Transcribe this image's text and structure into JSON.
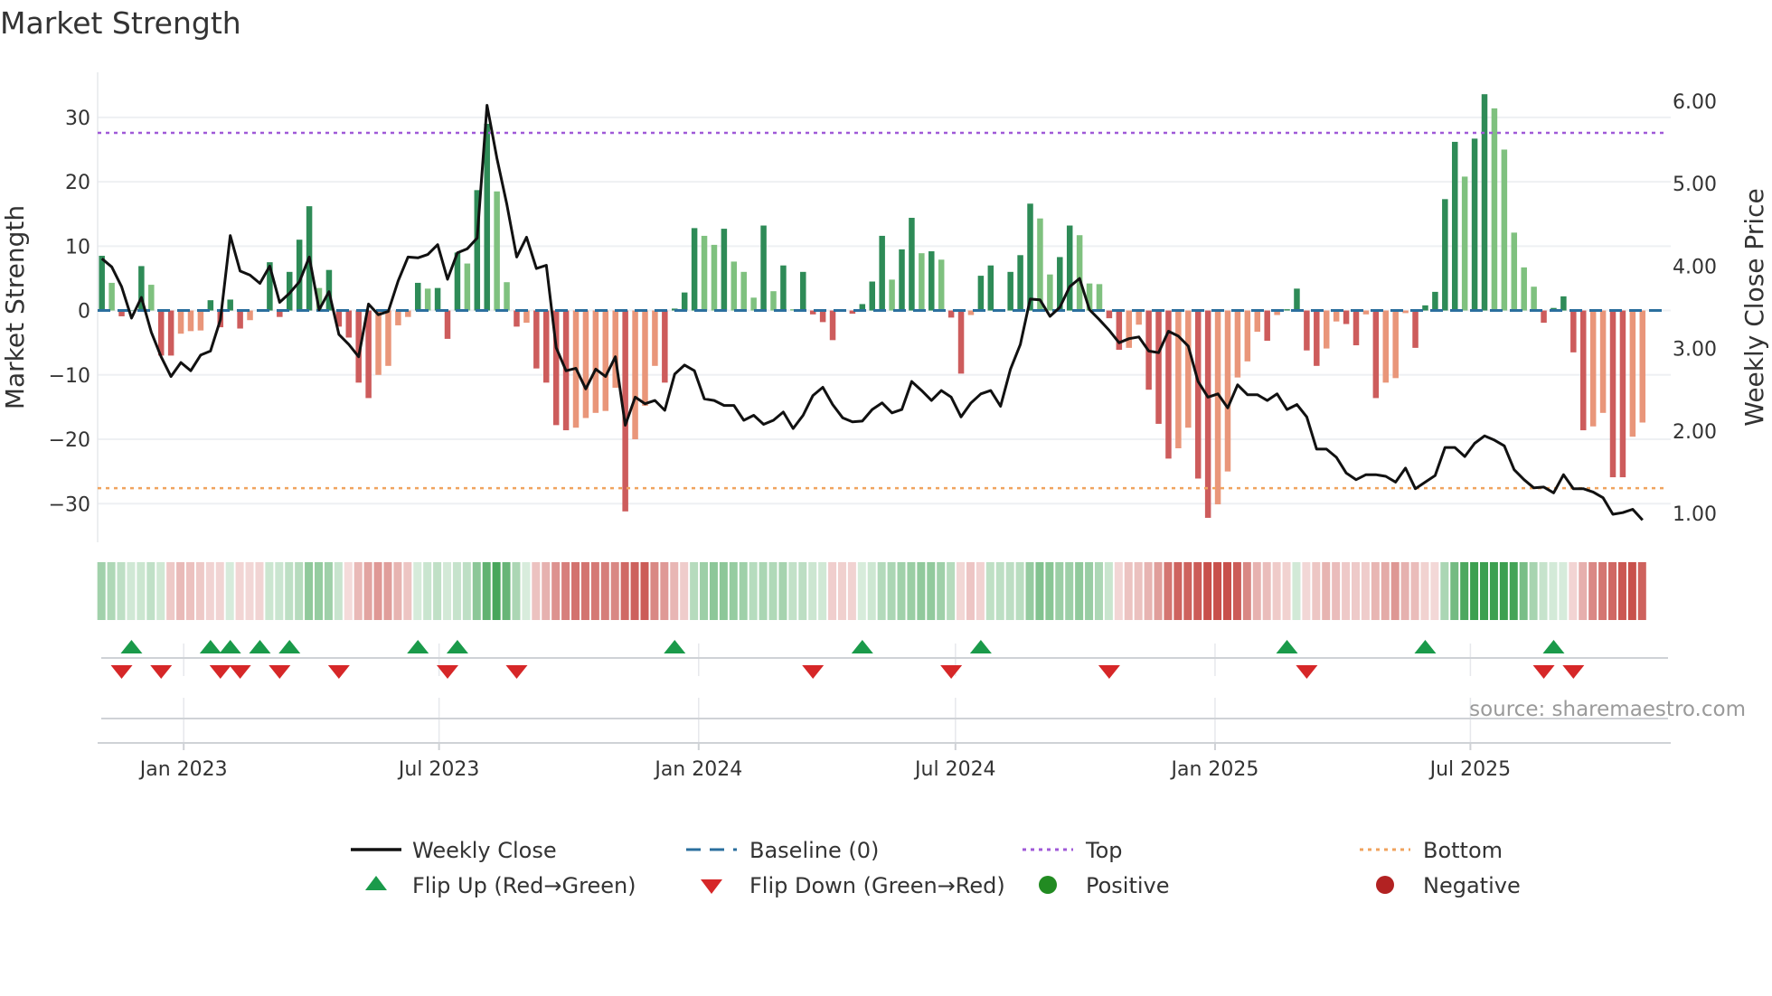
{
  "chart_data": {
    "type": "bar",
    "title": "Market Strength",
    "ylabel": "Market Strength",
    "y2label": "Weekly Close Price",
    "source": "source: sharemaestro.com",
    "x_start": "2022-11-04",
    "x_step_days": 7,
    "xlim": [
      "2022-11-01",
      "2025-11-20"
    ],
    "ylim": [
      -36,
      37
    ],
    "y2lim": [
      0.65,
      6.35
    ],
    "yticks": [
      30,
      20,
      10,
      0,
      -10,
      -20,
      -30
    ],
    "yticklabels": [
      "30",
      "20",
      "10",
      "0",
      "−10",
      "−20",
      "−30"
    ],
    "y2ticks": [
      6,
      5,
      4,
      3,
      2,
      1
    ],
    "y2ticklabels": [
      "6.00",
      "5.00",
      "4.00",
      "3.00",
      "2.00",
      "1.00"
    ],
    "xticks": [
      "2023-01-01",
      "2023-07-01",
      "2024-01-01",
      "2024-07-01",
      "2025-01-01",
      "2025-07-01"
    ],
    "xticklabels": [
      "Jan 2023",
      "Jul 2023",
      "Jan 2024",
      "Jul 2024",
      "Jan 2025",
      "Jul 2025"
    ],
    "top_level": 27.6,
    "bottom_level": -27.6,
    "strength": [
      8.5,
      4.3,
      -0.9,
      0,
      6.9,
      4.0,
      -7.0,
      -7.0,
      -3.6,
      -3.2,
      -3.1,
      1.6,
      -2.6,
      1.7,
      -2.8,
      -1.5,
      0,
      7.5,
      -1.0,
      6.0,
      11.0,
      16.2,
      3.5,
      6.3,
      -2.5,
      -4.2,
      -11.2,
      -13.6,
      -10.0,
      -8.6,
      -2.3,
      -1.0,
      4.3,
      3.4,
      3.5,
      -4.4,
      9.0,
      7.3,
      18.7,
      29.0,
      18.5,
      4.4,
      -2.5,
      -1.9,
      -9.0,
      -11.2,
      -17.8,
      -18.6,
      -18.2,
      -16.7,
      -15.9,
      -15.6,
      -12.0,
      -31.2,
      -20.0,
      -14.8,
      -8.6,
      -11.2,
      0.3,
      2.8,
      12.8,
      11.6,
      10.2,
      12.7,
      7.6,
      6.0,
      2.0,
      13.2,
      3.0,
      7.0,
      0.2,
      6.0,
      -0.6,
      -1.8,
      -4.6,
      0,
      -0.5,
      1.0,
      4.5,
      11.6,
      4.8,
      9.5,
      14.4,
      8.9,
      9.2,
      7.9,
      -1.1,
      -9.8,
      -0.7,
      5.4,
      7.0,
      0,
      6.0,
      8.6,
      16.6,
      14.3,
      5.6,
      8.3,
      13.2,
      11.7,
      4.2,
      4.1,
      -1.2,
      -6.1,
      -5.8,
      -2.2,
      -12.3,
      -17.6,
      -23.0,
      -21.4,
      -18.2,
      -26.1,
      -32.2,
      -30.1,
      -25.0,
      -10.4,
      -7.9,
      -3.3,
      -4.7,
      -0.7,
      0.2,
      3.4,
      -6.2,
      -8.6,
      -5.9,
      -1.7,
      -2.1,
      -5.4,
      -0.6,
      -13.6,
      -11.2,
      -10.5,
      -0.4,
      -5.8,
      0.8,
      2.9,
      17.3,
      26.2,
      20.8,
      26.7,
      33.6,
      31.4,
      25.0,
      12.1,
      6.7,
      3.7,
      -1.9,
      0.4,
      2.2,
      -6.5,
      -18.6,
      -18.0,
      -15.9,
      -25.9,
      -25.9,
      -19.6,
      -17.4
    ],
    "weekly_close": [
      4.09,
      3.99,
      3.75,
      3.37,
      3.62,
      3.2,
      2.9,
      2.66,
      2.83,
      2.73,
      2.92,
      2.97,
      3.35,
      4.37,
      3.94,
      3.89,
      3.79,
      4.0,
      3.56,
      3.67,
      3.81,
      4.11,
      3.47,
      3.69,
      3.17,
      3.05,
      2.9,
      3.54,
      3.41,
      3.45,
      3.82,
      4.11,
      4.1,
      4.14,
      4.26,
      3.84,
      4.16,
      4.21,
      4.34,
      5.95,
      5.31,
      4.75,
      4.11,
      4.35,
      3.97,
      4.01,
      3.01,
      2.73,
      2.76,
      2.51,
      2.75,
      2.66,
      2.9,
      2.07,
      2.41,
      2.33,
      2.37,
      2.25,
      2.69,
      2.8,
      2.73,
      2.39,
      2.37,
      2.31,
      2.31,
      2.13,
      2.19,
      2.08,
      2.13,
      2.23,
      2.03,
      2.19,
      2.43,
      2.53,
      2.32,
      2.16,
      2.11,
      2.12,
      2.26,
      2.34,
      2.22,
      2.26,
      2.6,
      2.49,
      2.37,
      2.49,
      2.41,
      2.17,
      2.34,
      2.45,
      2.49,
      2.3,
      2.75,
      3.05,
      3.6,
      3.59,
      3.39,
      3.5,
      3.75,
      3.85,
      3.47,
      3.35,
      3.22,
      3.07,
      3.12,
      3.14,
      2.97,
      2.95,
      3.21,
      3.15,
      3.03,
      2.6,
      2.41,
      2.45,
      2.28,
      2.56,
      2.44,
      2.44,
      2.37,
      2.45,
      2.26,
      2.32,
      2.17,
      1.78,
      1.78,
      1.68,
      1.49,
      1.41,
      1.47,
      1.47,
      1.45,
      1.38,
      1.55,
      1.3,
      1.38,
      1.46,
      1.8,
      1.8,
      1.69,
      1.85,
      1.94,
      1.89,
      1.82,
      1.53,
      1.41,
      1.31,
      1.32,
      1.25,
      1.47,
      1.3,
      1.3,
      1.26,
      1.19,
      0.99,
      1.01,
      1.05,
      0.92
    ],
    "flip_up_weeks": [
      3,
      11,
      13,
      16,
      19,
      32,
      36,
      58,
      77,
      89,
      120,
      134,
      147
    ],
    "flip_down_weeks": [
      2,
      6,
      12,
      14,
      18,
      24,
      35,
      42,
      72,
      86,
      102,
      122,
      146,
      149
    ],
    "legend": [
      {
        "label": "Weekly Close",
        "kind": "line",
        "color": "#111111"
      },
      {
        "label": "Baseline (0)",
        "kind": "dash",
        "color": "#2b6f9e"
      },
      {
        "label": "Top",
        "kind": "dot",
        "color": "#a05ad8"
      },
      {
        "label": "Bottom",
        "kind": "dot",
        "color": "#f0a35e"
      },
      {
        "label": "Flip Up (Red→Green)",
        "kind": "tri-up",
        "color": "#1a9a4a"
      },
      {
        "label": "Flip Down (Green→Red)",
        "kind": "tri-down",
        "color": "#d62728"
      },
      {
        "label": "Positive",
        "kind": "dot-marker",
        "color": "#228b22"
      },
      {
        "label": "Negative",
        "kind": "dot-marker",
        "color": "#b22222"
      }
    ],
    "legend_placement": "bottom",
    "colors": {
      "pos_rising": "#2e8b57",
      "pos_falling": "#7fc17f",
      "neg_falling": "#cd5c5c",
      "neg_rising": "#e9967a",
      "baseline": "#2b6f9e",
      "top": "#a05ad8",
      "bottom": "#f0a35e",
      "close": "#111111",
      "grid": "#eef0f3"
    }
  }
}
